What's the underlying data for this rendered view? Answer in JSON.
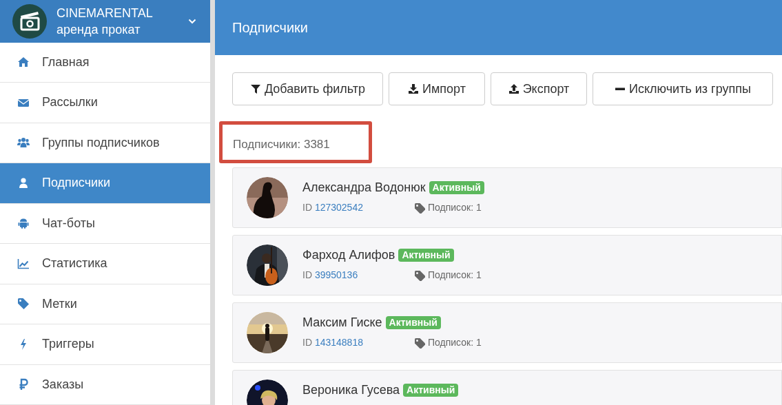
{
  "brand": {
    "name": "CINEMARENTAL",
    "subtitle": "аренда прокат"
  },
  "nav": [
    {
      "label": "Главная",
      "selected": false
    },
    {
      "label": "Рассылки",
      "selected": false
    },
    {
      "label": "Группы подписчиков",
      "selected": false
    },
    {
      "label": "Подписчики",
      "selected": true
    },
    {
      "label": "Чат-боты",
      "selected": false
    },
    {
      "label": "Статистика",
      "selected": false
    },
    {
      "label": "Метки",
      "selected": false
    },
    {
      "label": "Триггеры",
      "selected": false
    },
    {
      "label": "Заказы",
      "selected": false
    }
  ],
  "page_title": "Подписчики",
  "toolbar": [
    {
      "label": "Добавить фильтр"
    },
    {
      "label": "Импорт"
    },
    {
      "label": "Экспорт"
    },
    {
      "label": "Исключить из группы"
    }
  ],
  "count": "Подписчики: 3381",
  "subscribers": [
    {
      "name": "Александра Водонюк",
      "status_label": "Активный",
      "id_label": "ID",
      "id": "127302542",
      "subscriptions": "Подписок: 1"
    },
    {
      "name": "Фарход Алифов",
      "status_label": "Активный",
      "id_label": "ID",
      "id": "39950136",
      "subscriptions": "Подписок: 1"
    },
    {
      "name": "Максим Гиске",
      "status_label": "Активный",
      "id_label": "ID",
      "id": "143148818",
      "subscriptions": "Подписок: 1"
    },
    {
      "name": "Вероника Гусева",
      "status_label": "Активный"
    }
  ]
}
